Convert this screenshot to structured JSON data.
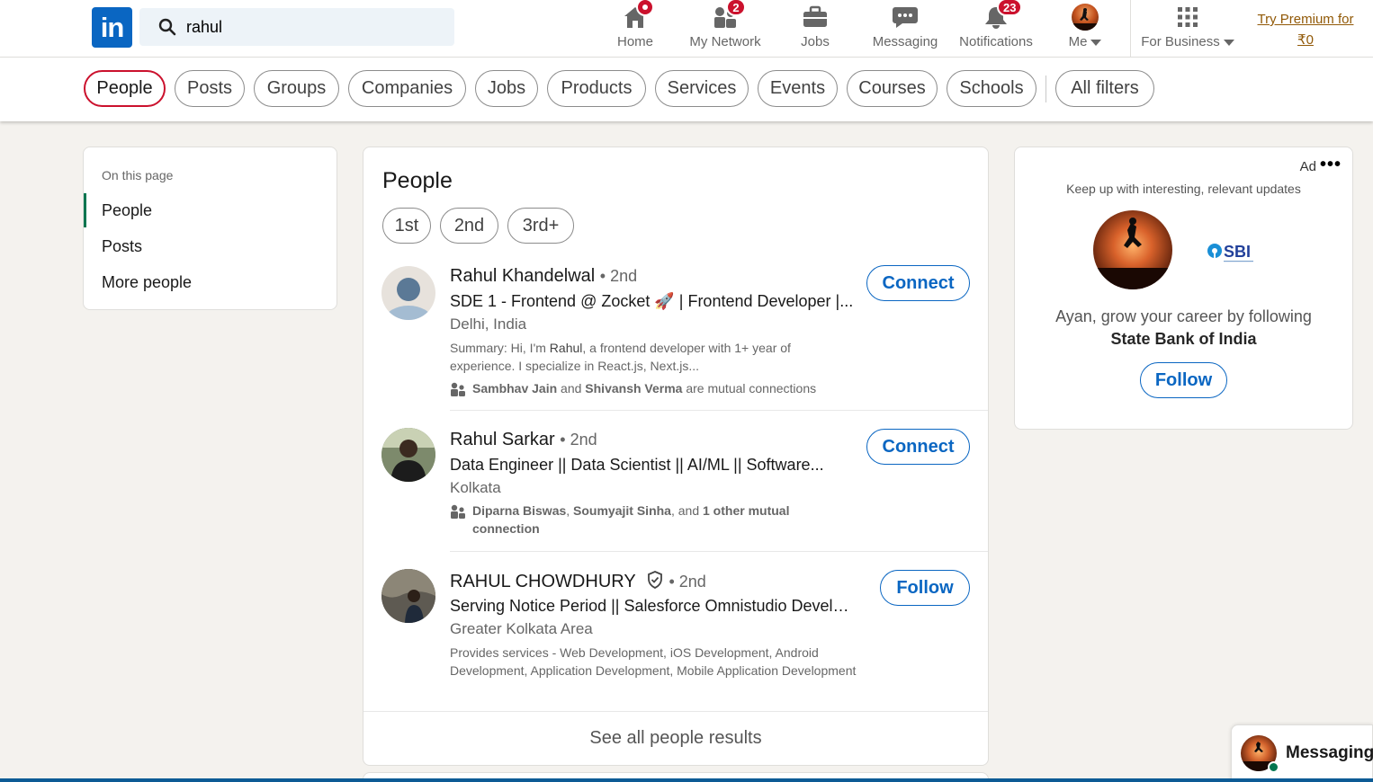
{
  "search": {
    "query": "rahul"
  },
  "nav": {
    "items": [
      {
        "label": "Home",
        "badge": ""
      },
      {
        "label": "My Network",
        "badge": "2"
      },
      {
        "label": "Jobs",
        "badge": ""
      },
      {
        "label": "Messaging",
        "badge": ""
      },
      {
        "label": "Notifications",
        "badge": "23"
      },
      {
        "label": "Me",
        "badge": ""
      },
      {
        "label": "For Business",
        "badge": ""
      }
    ],
    "premium_line1": "Try Premium for",
    "premium_line2": "₹0"
  },
  "filters": [
    "People",
    "Posts",
    "Groups",
    "Companies",
    "Jobs",
    "Products",
    "Services",
    "Events",
    "Courses",
    "Schools",
    "All filters"
  ],
  "on_this_page": {
    "title": "On this page",
    "items": [
      "People",
      "Posts",
      "More people"
    ]
  },
  "people": {
    "title": "People",
    "degrees": [
      "1st",
      "2nd",
      "3rd+"
    ],
    "results": [
      {
        "name": "Rahul Khandelwal",
        "degree": "• 2nd",
        "headline": "SDE 1 - Frontend @ Zocket 🚀 | Frontend Developer |...",
        "location": "Delhi, India",
        "summary_prefix": "Summary: Hi, I'm ",
        "summary_bold": "Rahul",
        "summary_suffix": ", a frontend developer with 1+ year of experience. I specialize in React.js, Next.js...",
        "mutual_a": "Sambhav Jain",
        "mutual_and": " and ",
        "mutual_b": "Shivansh Verma",
        "mutual_tail": " are mutual connections",
        "action": "Connect"
      },
      {
        "name": "Rahul Sarkar",
        "degree": "• 2nd",
        "headline": "Data Engineer || Data Scientist || AI/ML || Software...",
        "location": "Kolkata",
        "mutual_a": "Diparna Biswas",
        "mutual_and": ", ",
        "mutual_b": "Soumyajit Sinha",
        "mutual_mid": ", and ",
        "mutual_c": "1 other mutual connection",
        "action": "Connect"
      },
      {
        "name": "RAHUL CHOWDHURY",
        "degree": "• 2nd",
        "headline": "Serving Notice Period || Salesforce Omnistudio Develope...",
        "location": "Greater Kolkata Area",
        "services": "Provides services - Web Development, iOS Development, Android Development, Application Development, Mobile Application Development",
        "action": "Follow"
      }
    ],
    "see_all": "See all people results"
  },
  "ad": {
    "label": "Ad",
    "more": "•••",
    "subtitle": "Keep up with interesting, relevant updates",
    "logo_text": "SBI",
    "text_prefix": "Ayan, grow your career by following",
    "company": "State Bank of India",
    "action": "Follow"
  },
  "messaging": {
    "label": "Messaging"
  },
  "colors": {
    "brand": "#0a66c2",
    "badge": "#cb112d",
    "active_filter": "#cb112d",
    "premium": "#915907",
    "online": "#01754f"
  }
}
